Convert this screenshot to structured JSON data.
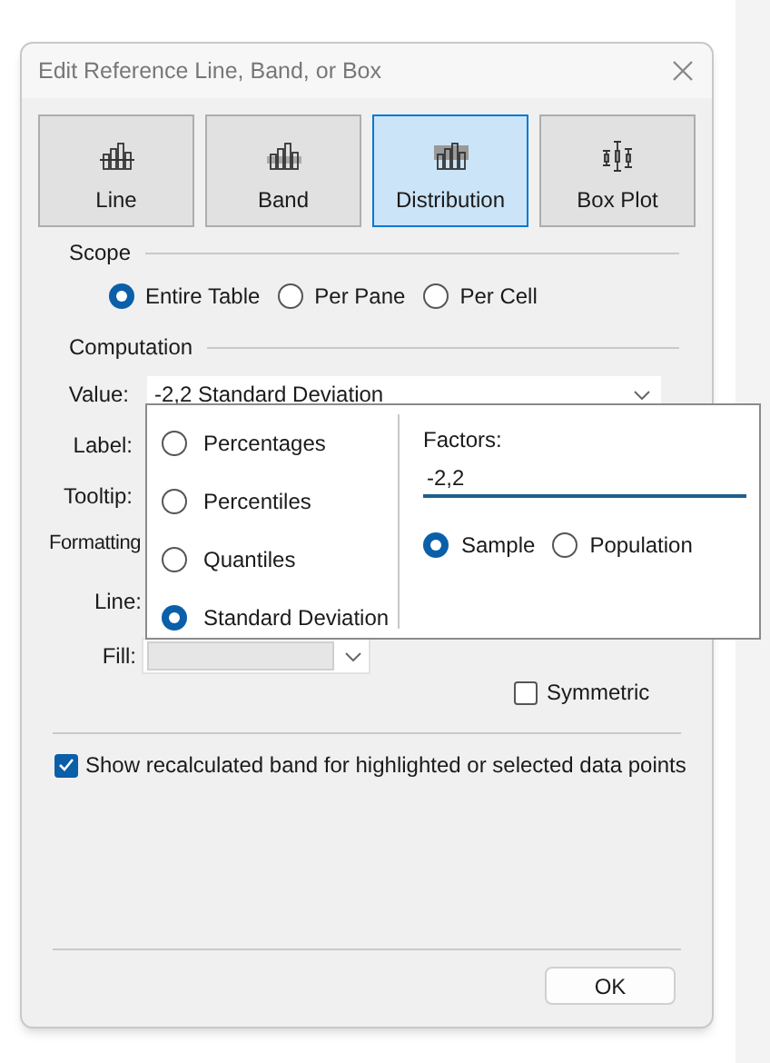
{
  "window": {
    "title": "Edit Reference Line, Band, or Box"
  },
  "types": [
    {
      "label": "Line",
      "kind": "line",
      "selected": false
    },
    {
      "label": "Band",
      "kind": "band",
      "selected": false
    },
    {
      "label": "Distribution",
      "kind": "distribution",
      "selected": true
    },
    {
      "label": "Box Plot",
      "kind": "boxplot",
      "selected": false
    }
  ],
  "scope": {
    "title": "Scope",
    "options": [
      {
        "label": "Entire Table",
        "selected": true
      },
      {
        "label": "Per Pane",
        "selected": false
      },
      {
        "label": "Per Cell",
        "selected": false
      }
    ]
  },
  "computation": {
    "title": "Computation",
    "value_label": "Value:",
    "value": "-2,2 Standard Deviation",
    "label_label": "Label:",
    "tooltip_label": "Tooltip:"
  },
  "formatting": {
    "title": "Formatting",
    "line_label": "Line:",
    "fill_label": "Fill:",
    "symmetric": {
      "label": "Symmetric",
      "checked": false
    }
  },
  "value_popup": {
    "methods": [
      {
        "label": "Percentages",
        "selected": false
      },
      {
        "label": "Percentiles",
        "selected": false
      },
      {
        "label": "Quantiles",
        "selected": false
      },
      {
        "label": "Standard Deviation",
        "selected": true
      }
    ],
    "factors_label": "Factors:",
    "factors_value": "-2,2",
    "sample_options": [
      {
        "label": "Sample",
        "selected": true
      },
      {
        "label": "Population",
        "selected": false
      }
    ]
  },
  "show_recalculated": {
    "label": "Show recalculated band for highlighted or selected data points",
    "checked": true
  },
  "buttons": [
    {
      "label": "OK"
    }
  ]
}
